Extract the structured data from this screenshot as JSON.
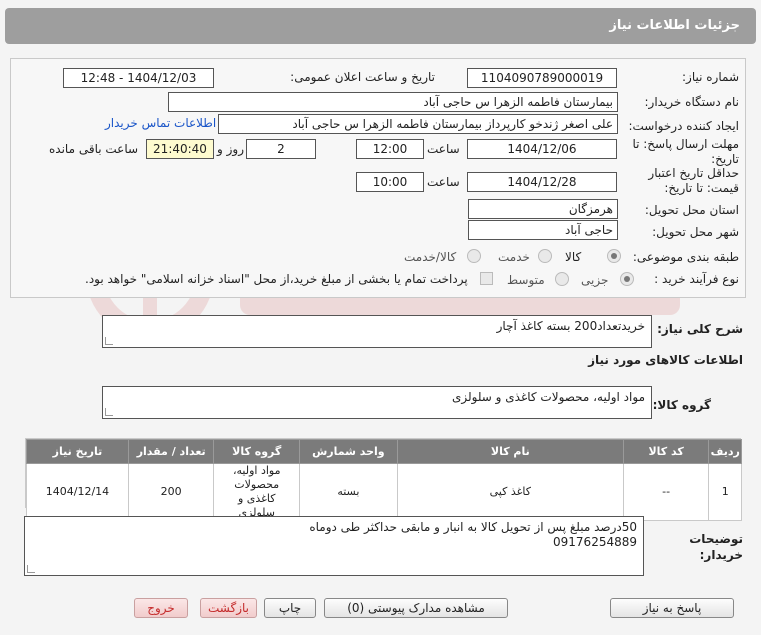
{
  "header": {
    "title": "جزئیات اطلاعات نیاز"
  },
  "form": {
    "need_number_label": "شماره نیاز:",
    "need_number": "1104090789000019",
    "announce_label": "تاریخ و ساعت اعلان عمومی:",
    "announce_value": "1404/12/03 - 12:48",
    "buyer_org_label": "نام دستگاه خریدار:",
    "buyer_org": "بیمارستان فاطمه الزهرا  س  حاجی آباد",
    "creator_label": "ایجاد کننده درخواست:",
    "creator": "علی اصغر ژندخو کارپرداز بیمارستان فاطمه الزهرا  س  حاجی آباد",
    "contact_link": "اطلاعات تماس خریدار",
    "deadline_label_1": "مهلت ارسال پاسخ: تا",
    "deadline_label_2": "تاریخ:",
    "deadline_date": "1404/12/06",
    "time_label": "ساعت",
    "deadline_time": "12:00",
    "days_value": "2",
    "days_label": "روز و",
    "remaining_time": "21:40:40",
    "remaining_label": "ساعت باقی مانده",
    "validity_label_1": "حداقل تاریخ اعتبار",
    "validity_label_2": "قیمت: تا تاریخ:",
    "validity_date": "1404/12/28",
    "validity_time": "10:00",
    "province_label": "استان محل تحویل:",
    "province": "هرمزگان",
    "city_label": "شهر محل تحویل:",
    "city": "حاجی آباد",
    "category_label": "طبقه بندی موضوعی:",
    "category_options": [
      "کالا",
      "خدمت",
      "کالا/خدمت"
    ],
    "process_label": "نوع فرآیند خرید :",
    "process_options": [
      "جزیی",
      "متوسط"
    ],
    "payment_note": "پرداخت تمام یا بخشی از مبلغ خرید،از محل \"اسناد خزانه اسلامی\" خواهد بود."
  },
  "summary": {
    "label": "شرح کلی نیاز:",
    "value": "خریدتعداد200 بسته کاغذ آچار"
  },
  "goods_section_title": "اطلاعات کالاهای مورد نیاز",
  "goods_group": {
    "label": "گروه کالا:",
    "value": "مواد اولیه، محصولات کاغذی و سلولزی"
  },
  "table": {
    "headers": [
      "ردیف",
      "کد کالا",
      "نام کالا",
      "واحد شمارش",
      "گروه کالا",
      "تعداد / مقدار",
      "تاریخ نیاز"
    ],
    "rows": [
      [
        "1",
        "--",
        "کاغذ کپی",
        "بسته",
        "مواد اولیه، محصولات کاغذی و سلولزی",
        "200",
        "1404/12/14"
      ]
    ]
  },
  "buyer_notes": {
    "label_1": "توضیحات",
    "label_2": "خریدار:",
    "line_1": "50درصد مبلغ پس از تحویل کالا به انبار و مابقی حداکثر طی دوماه",
    "line_2": "09176254889"
  },
  "buttons": {
    "reply": "پاسخ به نیاز",
    "attachments": "مشاهده مدارک پیوستی (0)",
    "print": "چاپ",
    "back": "بازگشت",
    "exit": "خروج"
  },
  "colors": {
    "header_bg": "#9e9e9e",
    "table_header_bg": "#7b7b7b",
    "link": "#1a55c8",
    "time_bg": "#fefbcf",
    "danger": "#c42b2b"
  }
}
